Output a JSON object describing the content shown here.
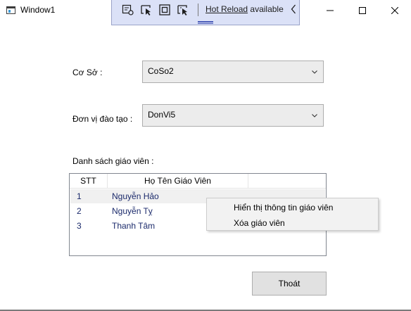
{
  "window": {
    "title": "Window1",
    "controls": {
      "minimize_icon": "minimize-icon",
      "maximize_icon": "maximize-icon",
      "close_icon": "close-icon"
    }
  },
  "hot_reload_toolbar": {
    "link_text": "Hot Reload",
    "status_text": "available",
    "icons": [
      "live-visual-tree-icon",
      "select-element-icon",
      "display-layout-adorners-icon",
      "track-focused-element-icon",
      "collapse-chevron-icon"
    ]
  },
  "form": {
    "co_so": {
      "label": "Cơ Sở :",
      "value": "CoSo2"
    },
    "don_vi": {
      "label": "Đơn vị đào tạo :",
      "value": "DonVi5"
    },
    "list_label": "Danh sách giáo viên :"
  },
  "teacher_list": {
    "columns": [
      "STT",
      "Họ Tên Giáo Viên"
    ],
    "rows": [
      {
        "stt": "1",
        "name": "Nguyễn Hảo",
        "selected": true
      },
      {
        "stt": "2",
        "name": "Nguyễn Tỵ",
        "selected": false
      },
      {
        "stt": "3",
        "name": "Thanh Tâm",
        "selected": false
      }
    ]
  },
  "context_menu": {
    "items": [
      "Hiển thị thông tin giáo viên",
      "Xóa giáo viên"
    ]
  },
  "buttons": {
    "exit_label": "Thoát"
  }
}
